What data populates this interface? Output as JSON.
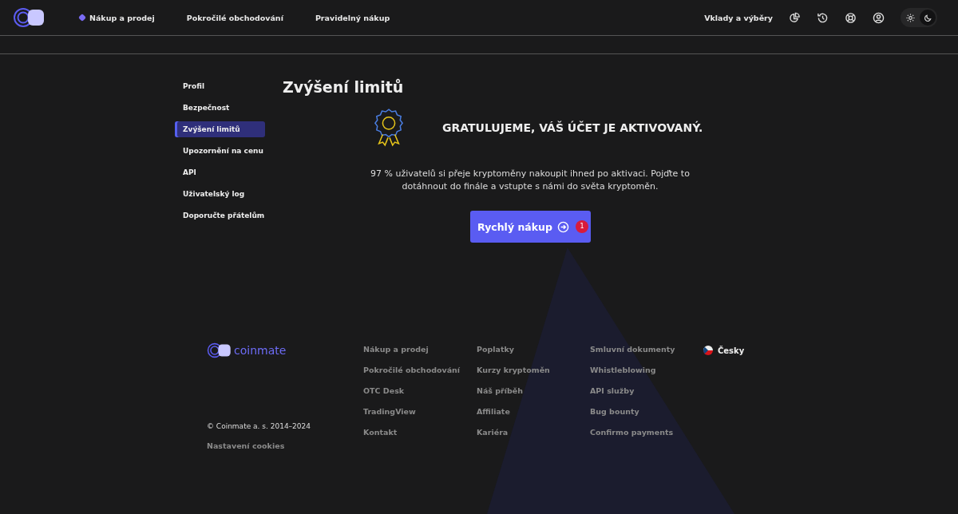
{
  "header": {
    "nav": [
      {
        "label": "Nákup a prodej",
        "selected": true
      },
      {
        "label": "Pokročilé obchodování",
        "selected": false
      },
      {
        "label": "Pravidelný nákup",
        "selected": false
      }
    ],
    "deposits_link": "Vklady a výběry",
    "theme": [
      {
        "kind": "light",
        "selected": false
      },
      {
        "kind": "dark",
        "selected": true
      }
    ]
  },
  "sidebar": {
    "items": [
      {
        "label": "Profil",
        "selected": false
      },
      {
        "label": "Bezpečnost",
        "selected": false
      },
      {
        "label": "Zvýšení limitů",
        "selected": true
      },
      {
        "label": "Upozornění na cenu",
        "selected": false
      },
      {
        "label": "API",
        "selected": false
      },
      {
        "label": "Uživatelský log",
        "selected": false
      },
      {
        "label": "Doporučte přátelům",
        "selected": false
      }
    ]
  },
  "content": {
    "title": "Zvýšení limitů",
    "headline": "GRATULUJEME, VÁŠ ÚČET JE AKTIVOVANÝ.",
    "text": "97 % uživatelů si přeje kryptoměny nakoupit ihned po aktivaci. Pojďte to dotáhnout do finále a vstupte s námi do světa kryptoměn.",
    "button": "Rychlý nákup",
    "badge": "1"
  },
  "footer": {
    "brand": "coinmate",
    "copyright": "© Coinmate a. s. 2014–2024",
    "cookies": "Nastavení cookies",
    "columns": [
      [
        "Nákup a prodej",
        "Pokročilé obchodování",
        "OTC Desk",
        "TradingView",
        "Kontakt"
      ],
      [
        "Poplatky",
        "Kurzy kryptoměn",
        "Náš příběh",
        "Affiliate",
        "Kariéra"
      ],
      [
        "Smluvní dokumenty",
        "Whistleblowing",
        "API služby",
        "Bug bounty",
        "Confirmo payments"
      ]
    ],
    "language": "Česky"
  }
}
